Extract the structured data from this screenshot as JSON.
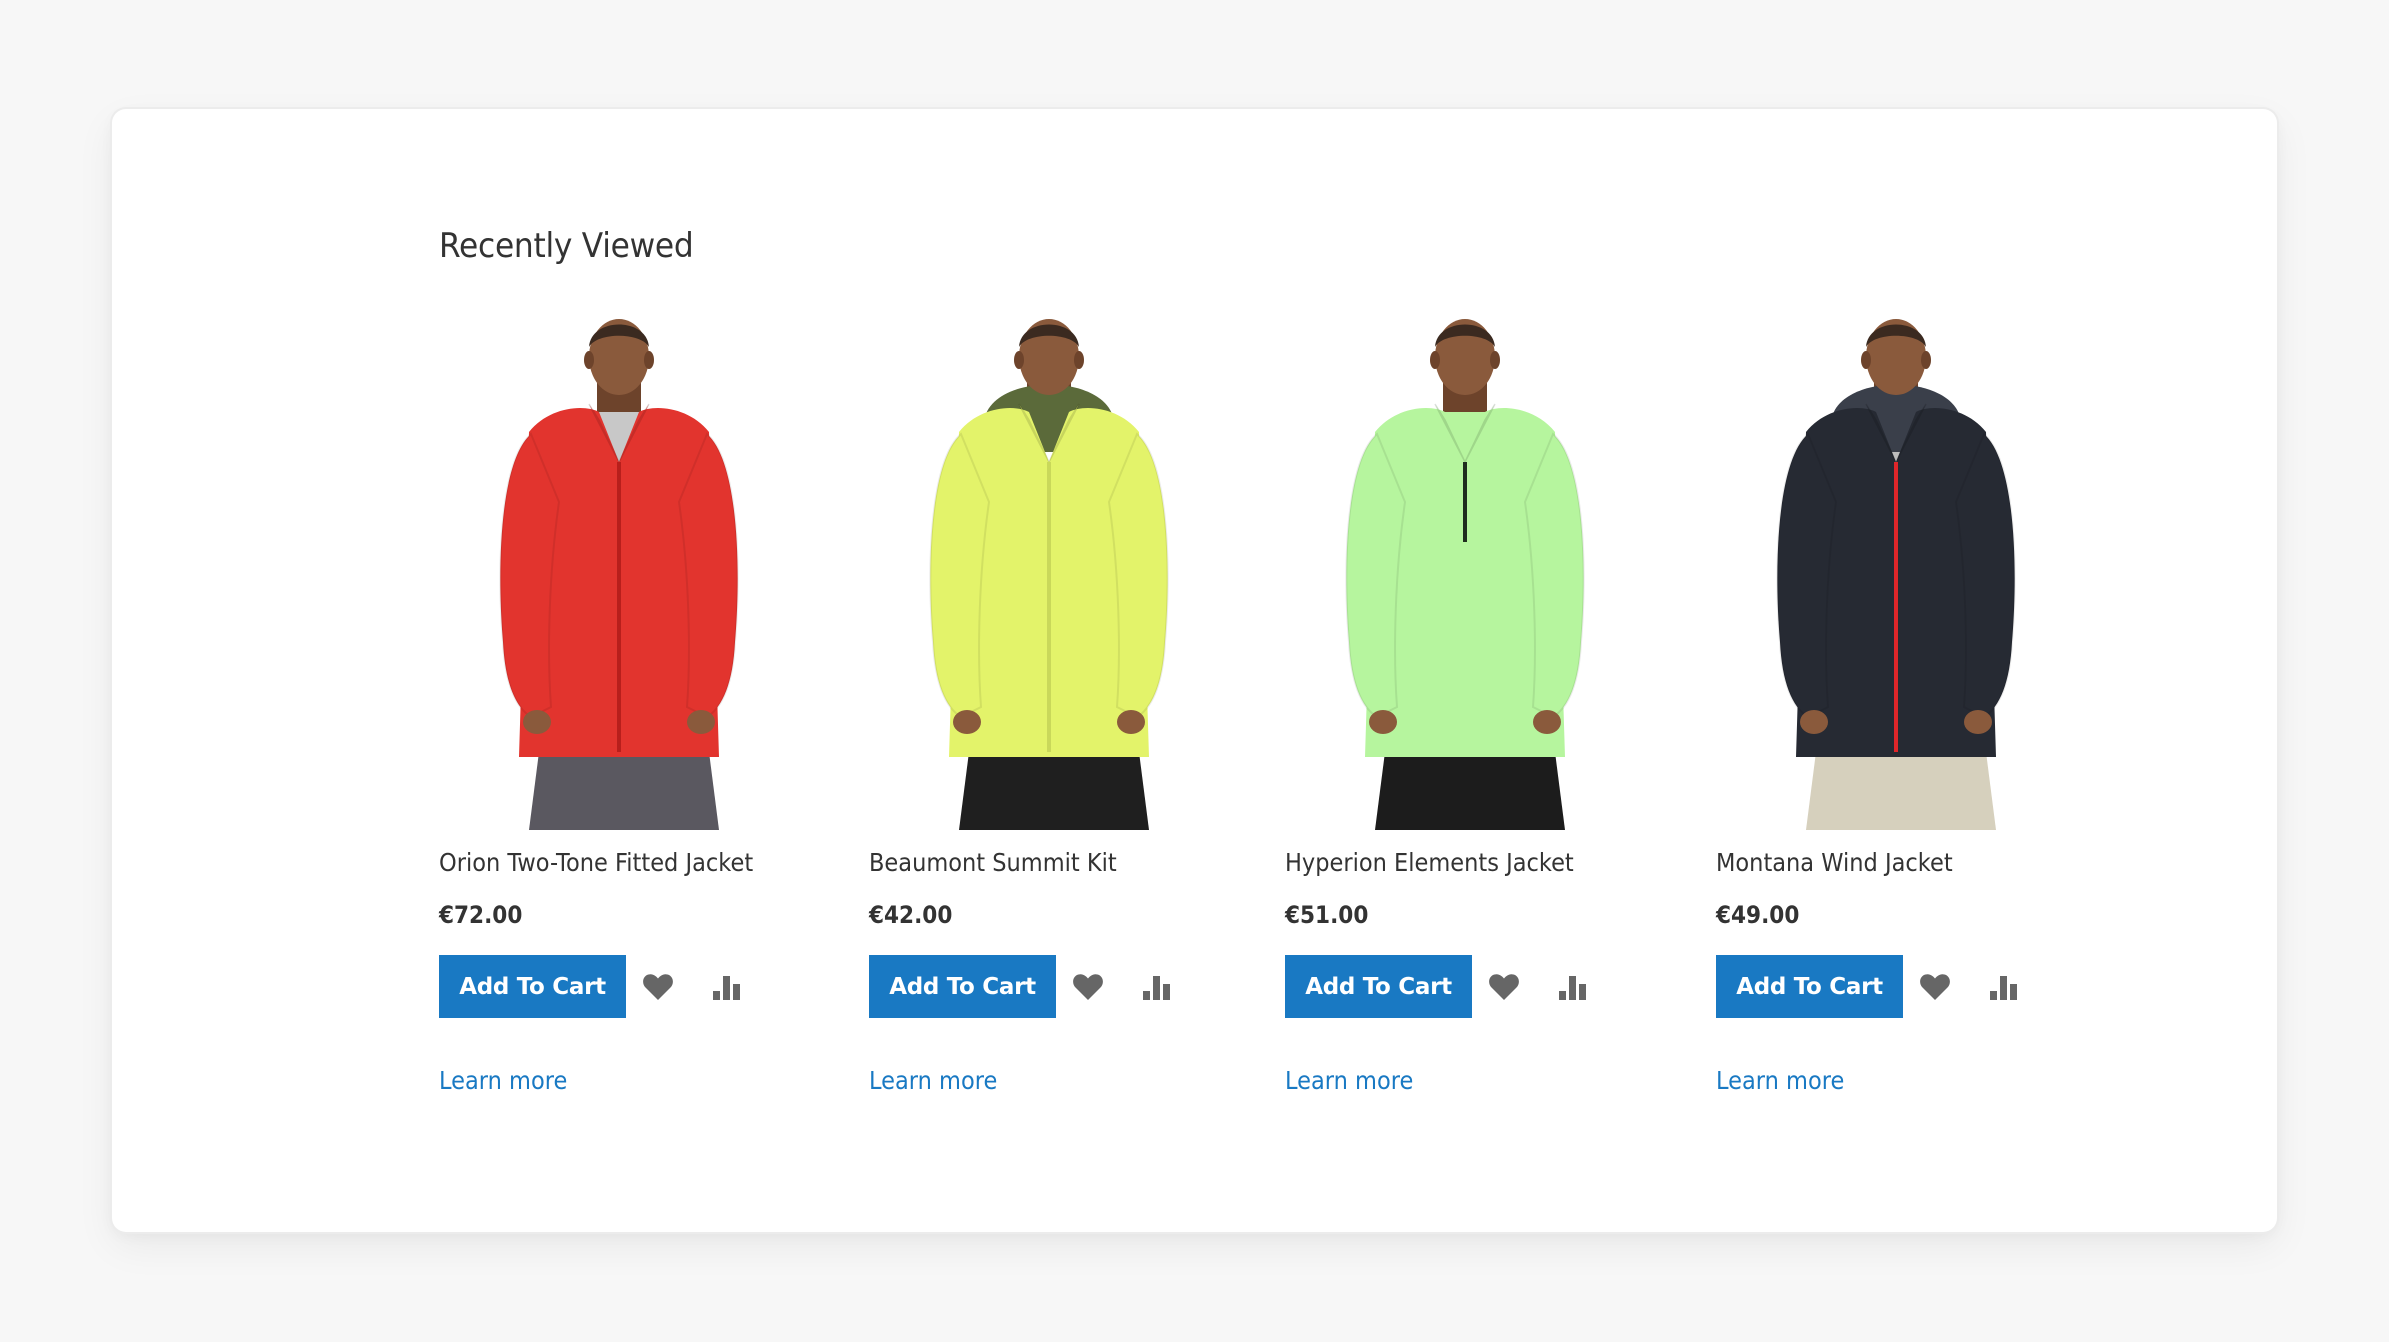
{
  "section": {
    "title": "Recently Viewed"
  },
  "colors": {
    "page_background": "#f7f7f7",
    "card_background": "#ffffff",
    "primary_button": "#1979c3",
    "link": "#1979c3",
    "icon": "#666666",
    "text": "#333333"
  },
  "products": [
    {
      "name": "Orion Two-Tone Fitted Jacket",
      "price": "€72.00",
      "add_to_cart_label": "Add To Cart",
      "wishlist_icon": "heart-icon",
      "compare_icon": "bar-chart-icon",
      "learn_more_label": "Learn more",
      "image": {
        "description": "Model wearing red full-zip fleece jacket with grey side panels and grey pants",
        "jacket_color": "#e2342e",
        "accent_color": "#9aa0a6",
        "zip_color": "#b81f1c",
        "pants_color": "#5a5860",
        "shirt_color": "#c8c8c8",
        "hood": false
      }
    },
    {
      "name": "Beaumont Summit Kit",
      "price": "€42.00",
      "add_to_cart_label": "Add To Cart",
      "wishlist_icon": "heart-icon",
      "compare_icon": "bar-chart-icon",
      "learn_more_label": "Learn more",
      "image": {
        "description": "Model wearing lime-yellow hooded windbreaker with black pants",
        "jacket_color": "#e3f36a",
        "accent_color": "#5b6a3a",
        "zip_color": "#c9d85a",
        "pants_color": "#1f1f1f",
        "shirt_color": "#ffffff",
        "hood": true
      }
    },
    {
      "name": "Hyperion Elements Jacket",
      "price": "€51.00",
      "add_to_cart_label": "Add To Cart",
      "wishlist_icon": "heart-icon",
      "compare_icon": "bar-chart-icon",
      "learn_more_label": "Learn more",
      "image": {
        "description": "Model wearing light green half-zip pullover with black pants",
        "jacket_color": "#b6f59e",
        "accent_color": "#9fe487",
        "zip_color": "#1e2d1e",
        "pants_color": "#1c1c1c",
        "shirt_color": "#b6f59e",
        "hood": false
      }
    },
    {
      "name": "Montana Wind Jacket",
      "price": "€49.00",
      "add_to_cart_label": "Add To Cart",
      "wishlist_icon": "heart-icon",
      "compare_icon": "bar-chart-icon",
      "learn_more_label": "Learn more",
      "image": {
        "description": "Model wearing dark navy quilted hooded jacket with red zipper and khaki pants",
        "jacket_color": "#262a33",
        "accent_color": "#3a3f4a",
        "zip_color": "#e0262a",
        "pants_color": "#d6d0bd",
        "shirt_color": "#bdbdbd",
        "hood": true
      }
    }
  ]
}
